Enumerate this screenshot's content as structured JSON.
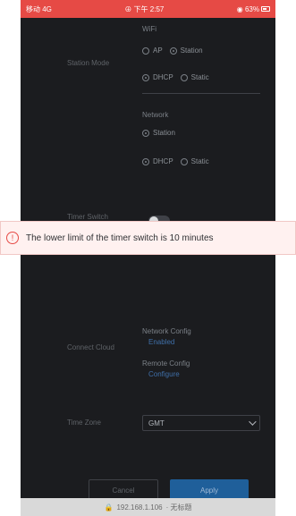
{
  "status_bar": {
    "carrier": "移动 4G",
    "center": "⊕ 下午 2:57",
    "battery": "◉ 63%"
  },
  "wifi_section": {
    "title": "WiFi",
    "left_label": "Station Mode",
    "mode_options": [
      {
        "label": "AP",
        "selected": false
      },
      {
        "label": "Station",
        "selected": true
      }
    ],
    "addr_options": [
      {
        "label": "DHCP",
        "selected": true
      },
      {
        "label": "Static",
        "selected": false
      }
    ]
  },
  "second_section": {
    "title": "Network",
    "mode_options": [
      {
        "label": "Station",
        "selected": true
      }
    ],
    "addr_options": [
      {
        "label": "DHCP",
        "selected": true
      },
      {
        "label": "Static",
        "selected": false
      }
    ]
  },
  "toggle_row": {
    "left_label": "Timer Switch",
    "on": true
  },
  "error_banner": {
    "icon": "info-circle-icon",
    "message": "The lower limit of the timer switch is 10 minutes"
  },
  "cloud_section": {
    "left_label": "Connect Cloud",
    "items": [
      {
        "title": "Network Config",
        "link": "Enabled"
      },
      {
        "title": "Remote Config",
        "link": "Configure"
      }
    ]
  },
  "time_section": {
    "left_label": "Time Zone",
    "select_value": "GMT"
  },
  "actions": {
    "cancel": "Cancel",
    "apply": "Apply"
  },
  "bottom_bar": {
    "lock_icon": "lock-icon",
    "address": "192.168.1.106",
    "suffix": "· 无标题"
  }
}
